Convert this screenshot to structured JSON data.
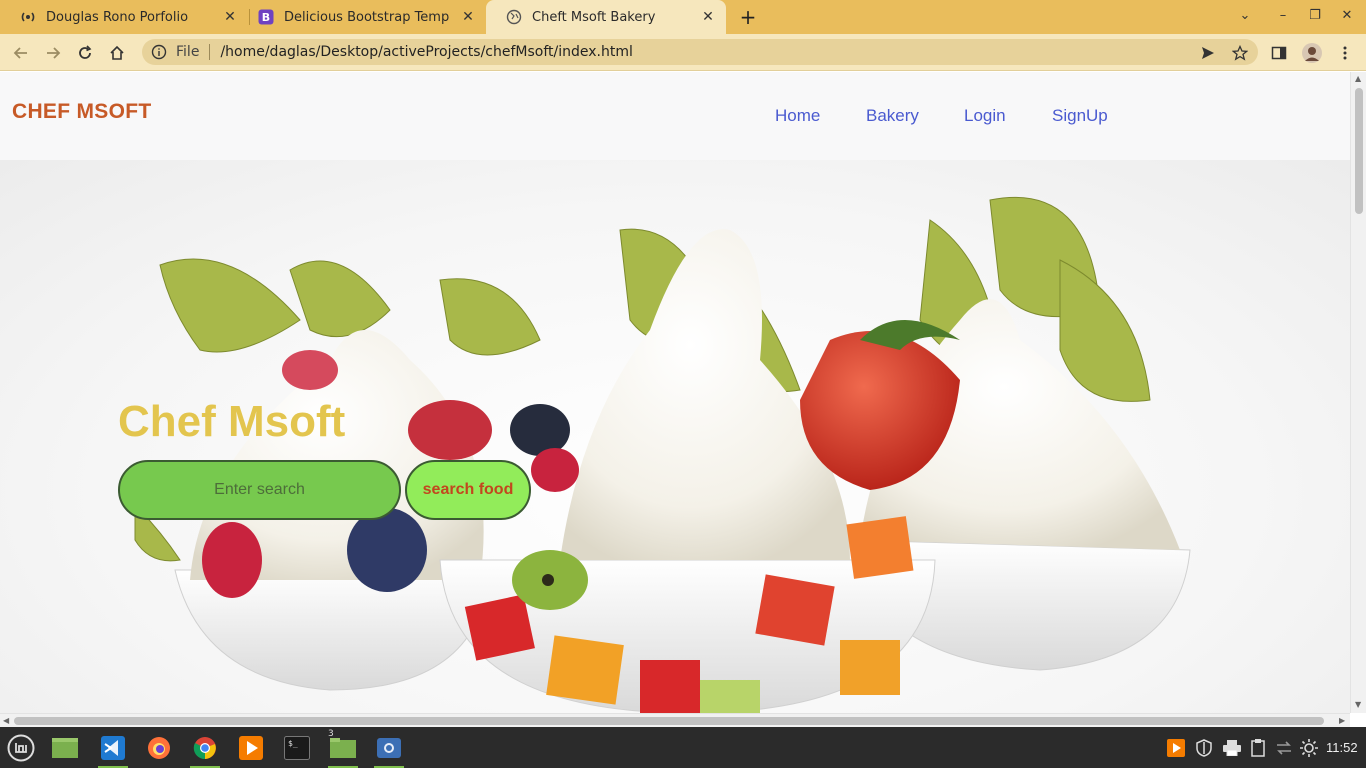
{
  "browser": {
    "tabs": [
      {
        "title": "Douglas Rono Porfolio",
        "favicon": "broadcast-icon",
        "active": false
      },
      {
        "title": "Delicious Bootstrap Template",
        "favicon": "bootstrap-icon",
        "active": false
      },
      {
        "title": "Cheft Msoft Bakery",
        "favicon": "globe-icon",
        "active": true
      }
    ],
    "address": {
      "scheme_label": "File",
      "url": "/home/daglas/Desktop/activeProjects/chefMsoft/index.html"
    }
  },
  "page": {
    "brand": "CHEF MSOFT",
    "nav": [
      "Home",
      "Bakery",
      "Login",
      "SignUp"
    ],
    "hero": {
      "title": "Chef Msoft",
      "search_placeholder": "Enter search",
      "search_button": "search food"
    }
  },
  "taskbar": {
    "apps": [
      "menu-icon",
      "files-icon",
      "vscode-icon",
      "firefox-icon",
      "chrome-icon",
      "media-player-icon",
      "terminal-icon",
      "folder-icon",
      "screenshot-icon"
    ],
    "folder_badge": "3",
    "clock": "11:52"
  },
  "colors": {
    "tabbar": "#e9bd5c",
    "toolbar": "#f6e7bd",
    "brand": "#c75a27",
    "nav_link": "#4a5ad0",
    "hero_title": "#e3c54e",
    "search_input_bg": "#77c94e",
    "search_button_bg": "#92ec5a",
    "search_button_text": "#c2471e"
  }
}
